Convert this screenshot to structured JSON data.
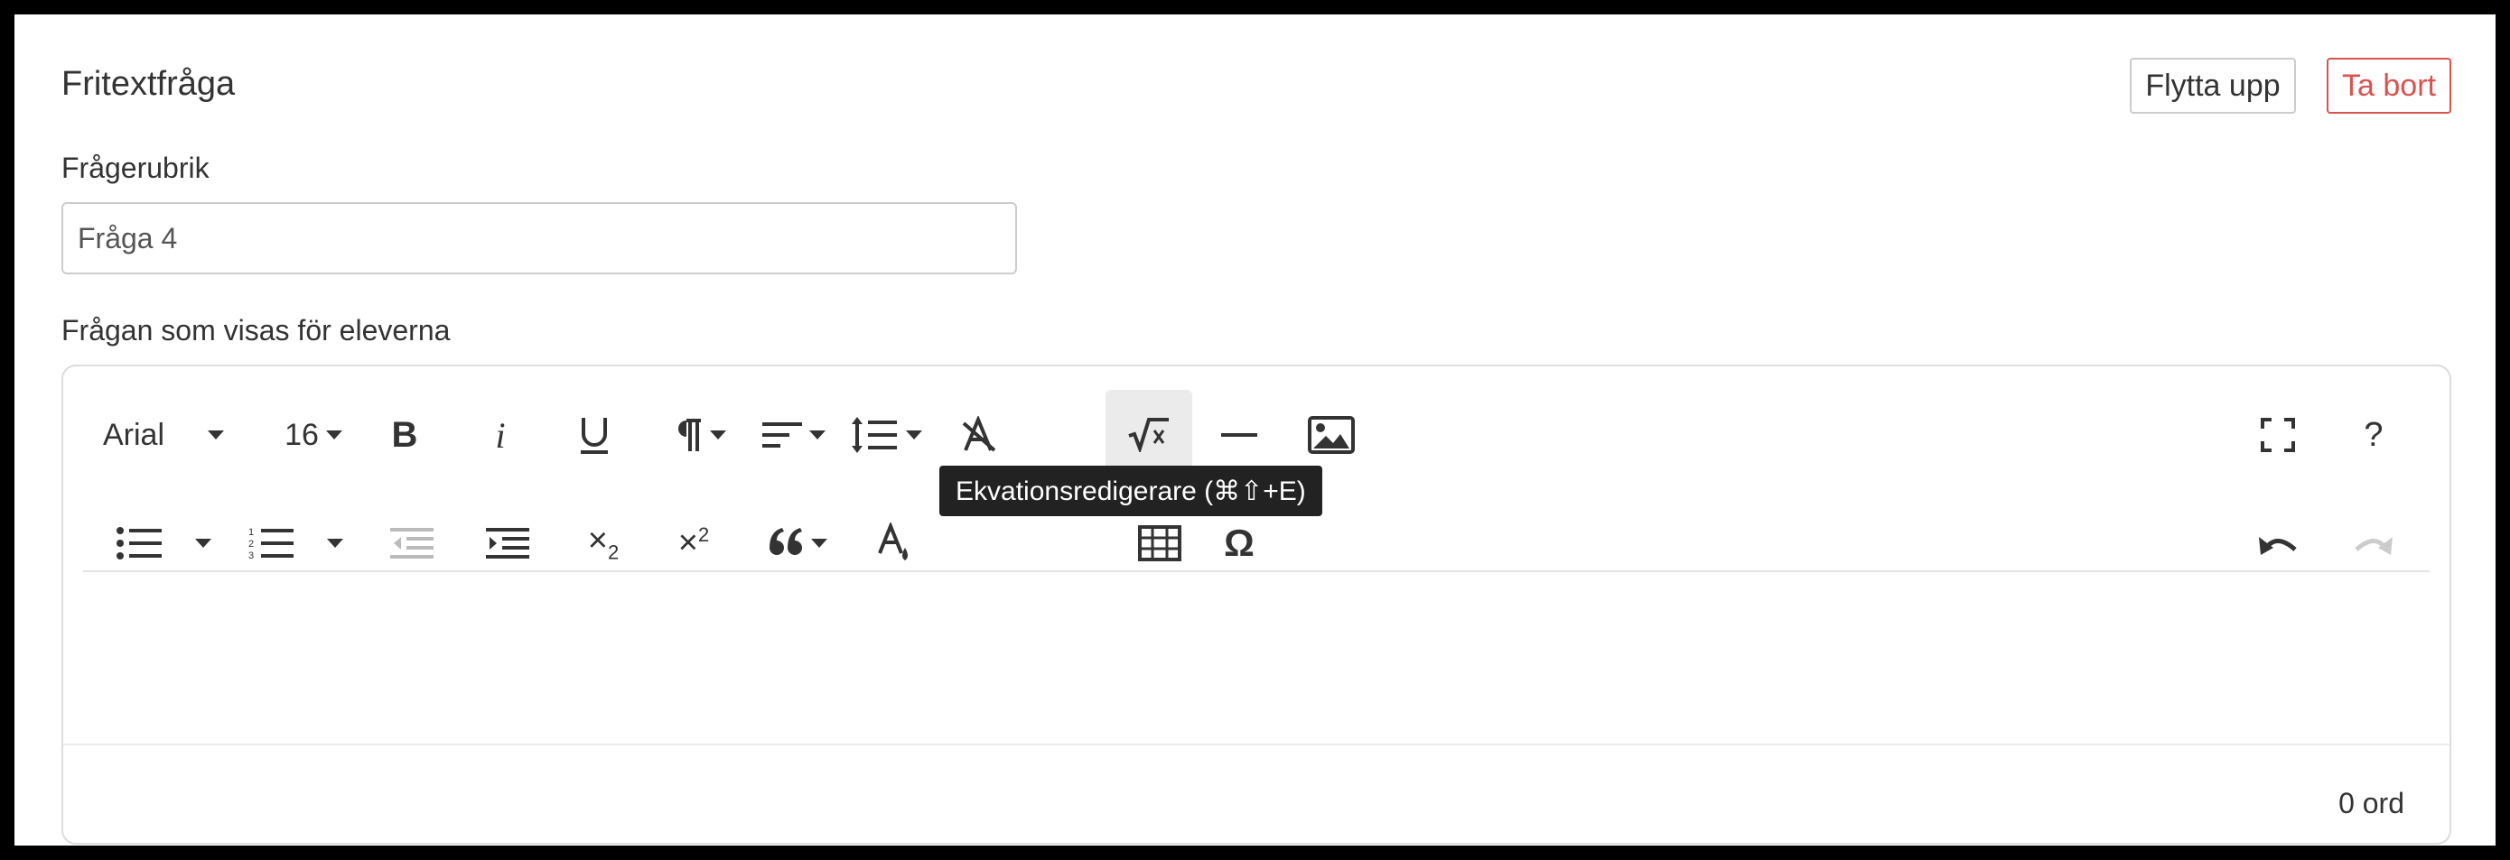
{
  "form": {
    "title": "Fritextfråga",
    "move_up_label": "Flytta upp",
    "delete_label": "Ta bort",
    "heading_label": "Frågerubrik",
    "heading_value": "Fråga 4",
    "question_label": "Frågan som visas för eleverna"
  },
  "toolbar": {
    "font_family": "Arial",
    "font_size": "16",
    "bold": "B",
    "italic": "i",
    "subscript_base": "×",
    "subscript_sub": "2",
    "superscript_base": "×",
    "superscript_sup": "2",
    "omega": "Ω",
    "help": "?",
    "equation": "√x"
  },
  "tooltip": {
    "text": "Ekvationsredigerare (⌘⇧+E)"
  },
  "footer": {
    "word_count": "0 ord"
  }
}
